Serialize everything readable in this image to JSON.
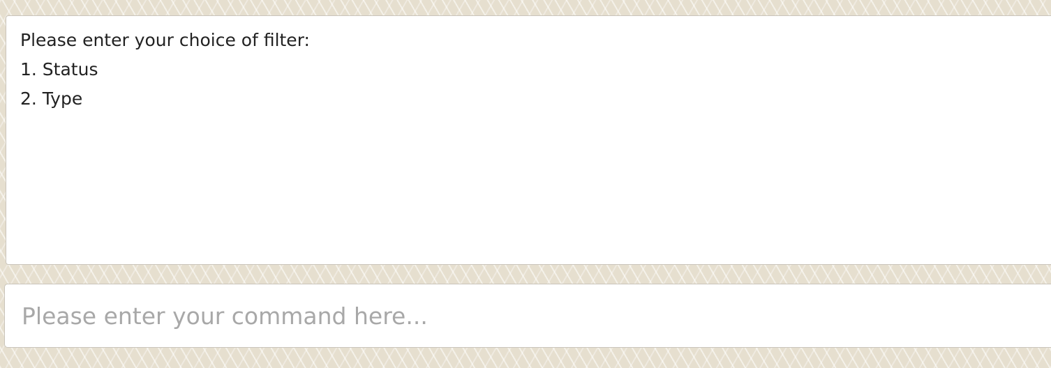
{
  "output": {
    "lines": [
      "Please enter your choice of filter:",
      "1. Status",
      "2. Type"
    ]
  },
  "command": {
    "value": "",
    "placeholder": "Please enter your command here..."
  }
}
